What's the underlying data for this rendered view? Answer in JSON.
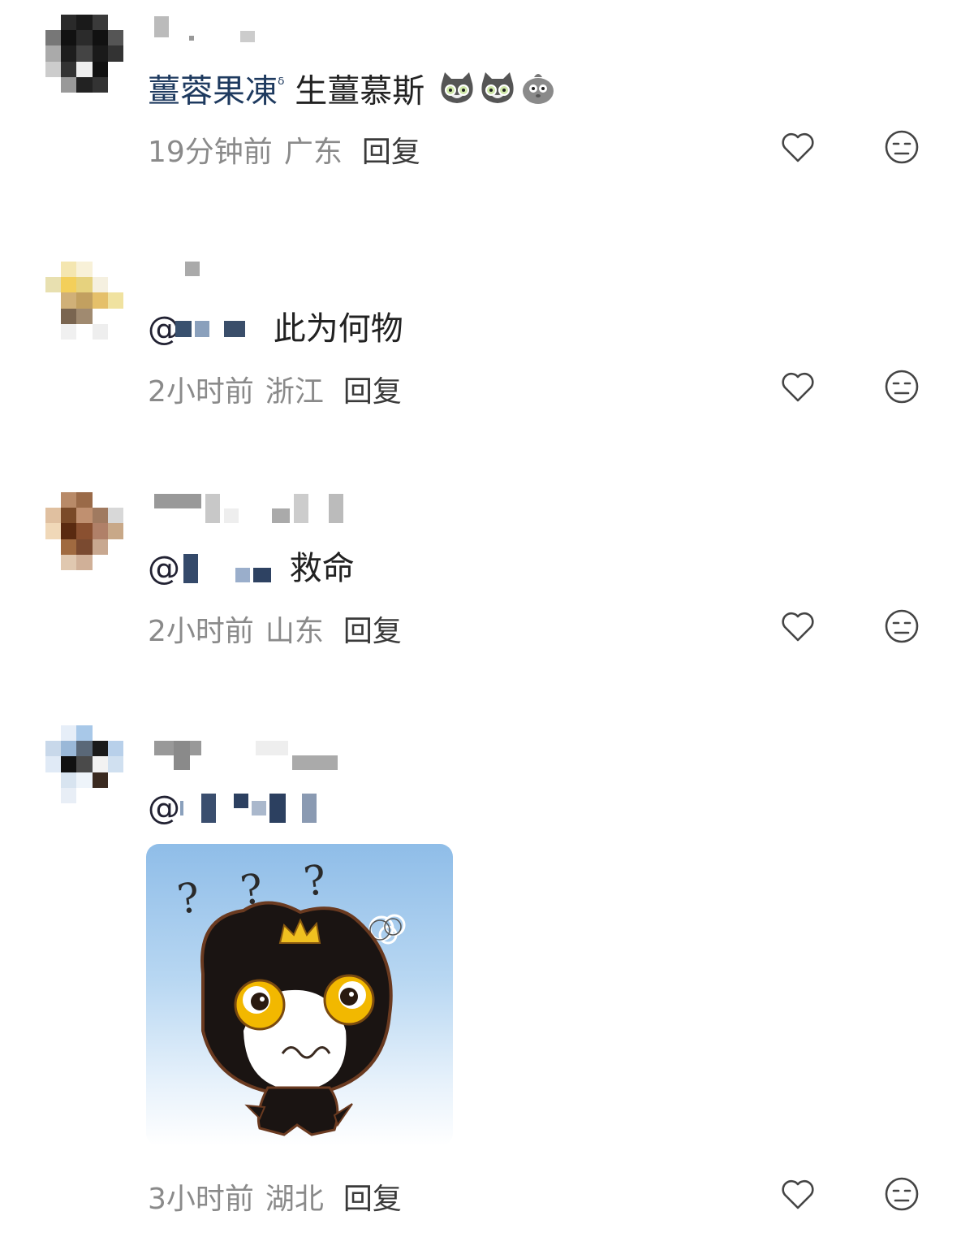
{
  "comments": [
    {
      "body": {
        "highlight": "薑蓉果凍",
        "search_mark": "ᵟ",
        "text": "生薑慕斯"
      },
      "meta": {
        "time": "19分钟前",
        "region": "广东",
        "reply": "回复"
      },
      "emojis": [
        "cat-glasses-emoji",
        "cat-glasses-emoji",
        "gray-bird-emoji"
      ]
    },
    {
      "body": {
        "at": "@",
        "text": "此为何物"
      },
      "meta": {
        "time": "2小时前",
        "region": "浙江",
        "reply": "回复"
      }
    },
    {
      "body": {
        "at": "@",
        "text": "救命"
      },
      "meta": {
        "time": "2小时前",
        "region": "山东",
        "reply": "回复"
      }
    },
    {
      "body": {
        "at": "@"
      },
      "sticker": {
        "marks": "? ? ?",
        "icon": "confused-black-cat-sticker"
      },
      "meta": {
        "time": "3小时前",
        "region": "湖北",
        "reply": "回复"
      }
    }
  ],
  "icons": {
    "like": "heart-outline-icon",
    "reaction": "meh-face-icon"
  },
  "colors": {
    "link": "#1e3a5f",
    "meta": "#8a8a8a",
    "reply": "#3a3a3a"
  }
}
